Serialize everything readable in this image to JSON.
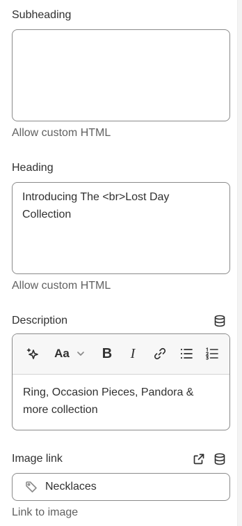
{
  "subheading": {
    "label": "Subheading",
    "value": "",
    "help": "Allow custom HTML"
  },
  "heading": {
    "label": "Heading",
    "value": "Introducing The <br>Lost Day\nCollection",
    "help": "Allow custom HTML"
  },
  "description": {
    "label": "Description",
    "label_icon": "database-icon",
    "toolbar": {
      "items": [
        "magic-icon",
        "font-size-icon",
        "chevron-down-icon",
        "bold-icon",
        "italic-icon",
        "link-icon",
        "bullet-list-icon",
        "numbered-list-icon"
      ],
      "font_label": "Aa",
      "bold_label": "B",
      "italic_label": "I"
    },
    "value": "Ring, Occasion Pieces, Pandora & more collection"
  },
  "image_link": {
    "label": "Image link",
    "icons": [
      "external-link-icon",
      "database-icon"
    ],
    "value_icon": "tag-icon",
    "value": "Necklaces",
    "help": "Link to image"
  }
}
